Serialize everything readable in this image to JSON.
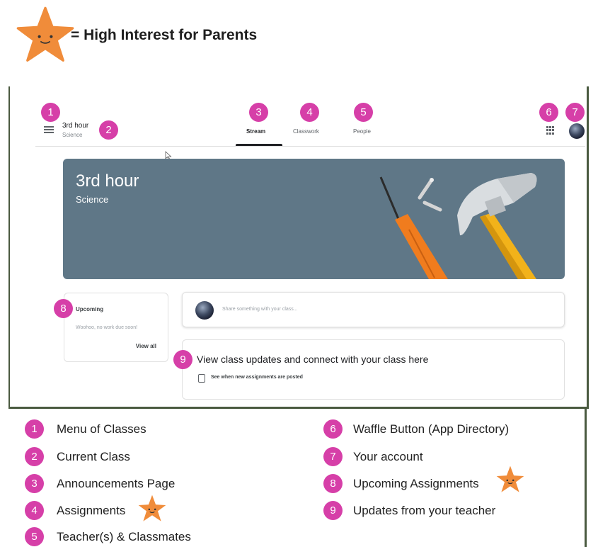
{
  "legend_header": {
    "text": "= High Interest for Parents",
    "star_icon": "star-face-icon",
    "star_color": "#f08c3a"
  },
  "classroom": {
    "class_name": "3rd hour",
    "class_subject": "Science",
    "tabs": [
      "Stream",
      "Classwork",
      "People"
    ],
    "active_tab": "Stream",
    "banner": {
      "title": "3rd hour",
      "subtitle": "Science",
      "color": "#5f7787"
    },
    "upcoming": {
      "title": "Upcoming",
      "text": "Woohoo, no work due soon!",
      "view_all": "View all"
    },
    "share_placeholder": "Share something with your class...",
    "updates": {
      "headline": "View class updates and connect with your class here",
      "subtext": "See when new assignments are posted"
    }
  },
  "callouts": [
    "1",
    "2",
    "3",
    "4",
    "5",
    "6",
    "7",
    "8",
    "9"
  ],
  "badge_color": "#d63fa8",
  "legend_items": [
    {
      "number": "1",
      "label": "Menu of Classes"
    },
    {
      "number": "2",
      "label": "Current Class"
    },
    {
      "number": "3",
      "label": "Announcements Page"
    },
    {
      "number": "4",
      "label": "Assignments",
      "high_interest": true
    },
    {
      "number": "5",
      "label": "Teacher(s) & Classmates"
    },
    {
      "number": "6",
      "label": "Waffle Button (App Directory)"
    },
    {
      "number": "7",
      "label": "Your account"
    },
    {
      "number": "8",
      "label": "Upcoming Assignments",
      "high_interest": true
    },
    {
      "number": "9",
      "label": "Updates from your teacher"
    }
  ]
}
